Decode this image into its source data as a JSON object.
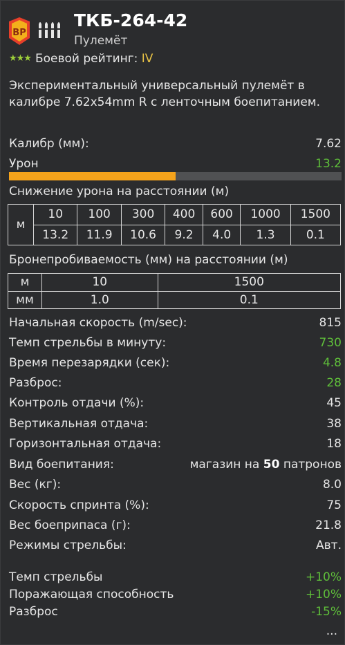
{
  "header": {
    "title": "ТКБ-264-42",
    "subtitle": "Пулемёт",
    "rating_label": "Боевой рейтинг:",
    "rating_value": "IV",
    "rating_stars": 3,
    "badge_icon": "battle-pass-badge-icon",
    "ammo_icon": "ammo-bullets-icon"
  },
  "description": "Экспериментальный универсальный пулемёт в калибре 7.62x54mm R с ленточным боепитанием.",
  "caliber": {
    "label": "Калибр (мм):",
    "value": "7.62"
  },
  "damage": {
    "label": "Урон",
    "value": "13.2",
    "bar_fraction": 0.5
  },
  "falloff": {
    "title": "Снижение урона на расстоянии (м)",
    "row_header": "м",
    "columns": [
      {
        "dist": "10",
        "dmg": "13.2"
      },
      {
        "dist": "100",
        "dmg": "11.9"
      },
      {
        "dist": "300",
        "dmg": "10.6"
      },
      {
        "dist": "400",
        "dmg": "9.2"
      },
      {
        "dist": "600",
        "dmg": "4.0"
      },
      {
        "dist": "1000",
        "dmg": "1.3"
      },
      {
        "dist": "1500",
        "dmg": "0.1"
      }
    ]
  },
  "penetration": {
    "title": "Бронепробиваемость (мм) на расстоянии (м)",
    "row_header_top": "м",
    "row_header_bottom": "мм",
    "columns": [
      {
        "dist": "10",
        "pen": "1.0"
      },
      {
        "dist": "1500",
        "pen": "0.1"
      }
    ]
  },
  "stats": [
    {
      "label": "Начальная скорость (m/sec):",
      "value": "815",
      "green": false
    },
    {
      "label": "Темп стрельбы в минуту:",
      "value": "730",
      "green": true
    },
    {
      "label": "Время перезарядки (сек):",
      "value": "4.8",
      "green": true
    },
    {
      "label": "Разброс:",
      "value": "28",
      "green": true
    },
    {
      "label": "Контроль отдачи (%):",
      "value": "45",
      "green": false
    },
    {
      "label": "Вертикальная отдача:",
      "value": "38",
      "green": false
    },
    {
      "label": "Горизонтальная отдача:",
      "value": "18",
      "green": false
    },
    {
      "label": "Вид боепитания:",
      "value": "",
      "green": false
    },
    {
      "label": "Вес (кг):",
      "value": "8.0",
      "green": false
    },
    {
      "label": "Скорость спринта (%):",
      "value": "75",
      "green": false
    },
    {
      "label": "Вес боеприпаса (г):",
      "value": "21.8",
      "green": false
    },
    {
      "label": "Режимы стрельбы:",
      "value": "Авт.",
      "green": false
    }
  ],
  "feed": {
    "prefix": "магазин на",
    "count": "50",
    "suffix": "патронов"
  },
  "modifiers": [
    {
      "label": "Темп стрельбы",
      "value": "+10%"
    },
    {
      "label": "Поражающая способность",
      "value": "+10%"
    },
    {
      "label": "Разброс",
      "value": "-15%"
    }
  ],
  "ellipsis": "...",
  "colors": {
    "accent": "#f5a31b",
    "positive": "#5fbf3a",
    "rating": "#e8c245",
    "background": "#2b2c2e"
  }
}
